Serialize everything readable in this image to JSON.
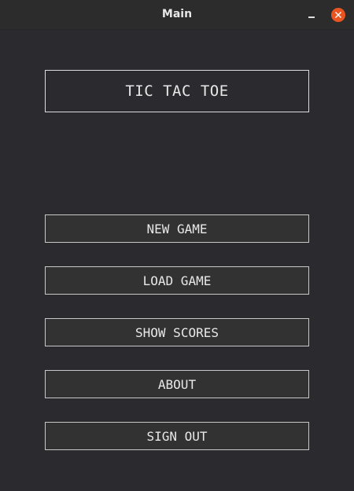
{
  "window": {
    "title": "Main"
  },
  "main": {
    "heading": "TIC TAC TOE",
    "buttons": [
      {
        "label": "NEW GAME"
      },
      {
        "label": "LOAD GAME"
      },
      {
        "label": "SHOW SCORES"
      },
      {
        "label": "ABOUT"
      },
      {
        "label": "SIGN OUT"
      }
    ]
  },
  "icons": {
    "minimize": "minimize-icon",
    "close": "close-icon"
  },
  "colors": {
    "background": "#2b2b2f",
    "titlebar": "#2c2c2c",
    "close_button": "#e95420",
    "text": "#e8e8e8",
    "border": "#dcdcdc"
  }
}
